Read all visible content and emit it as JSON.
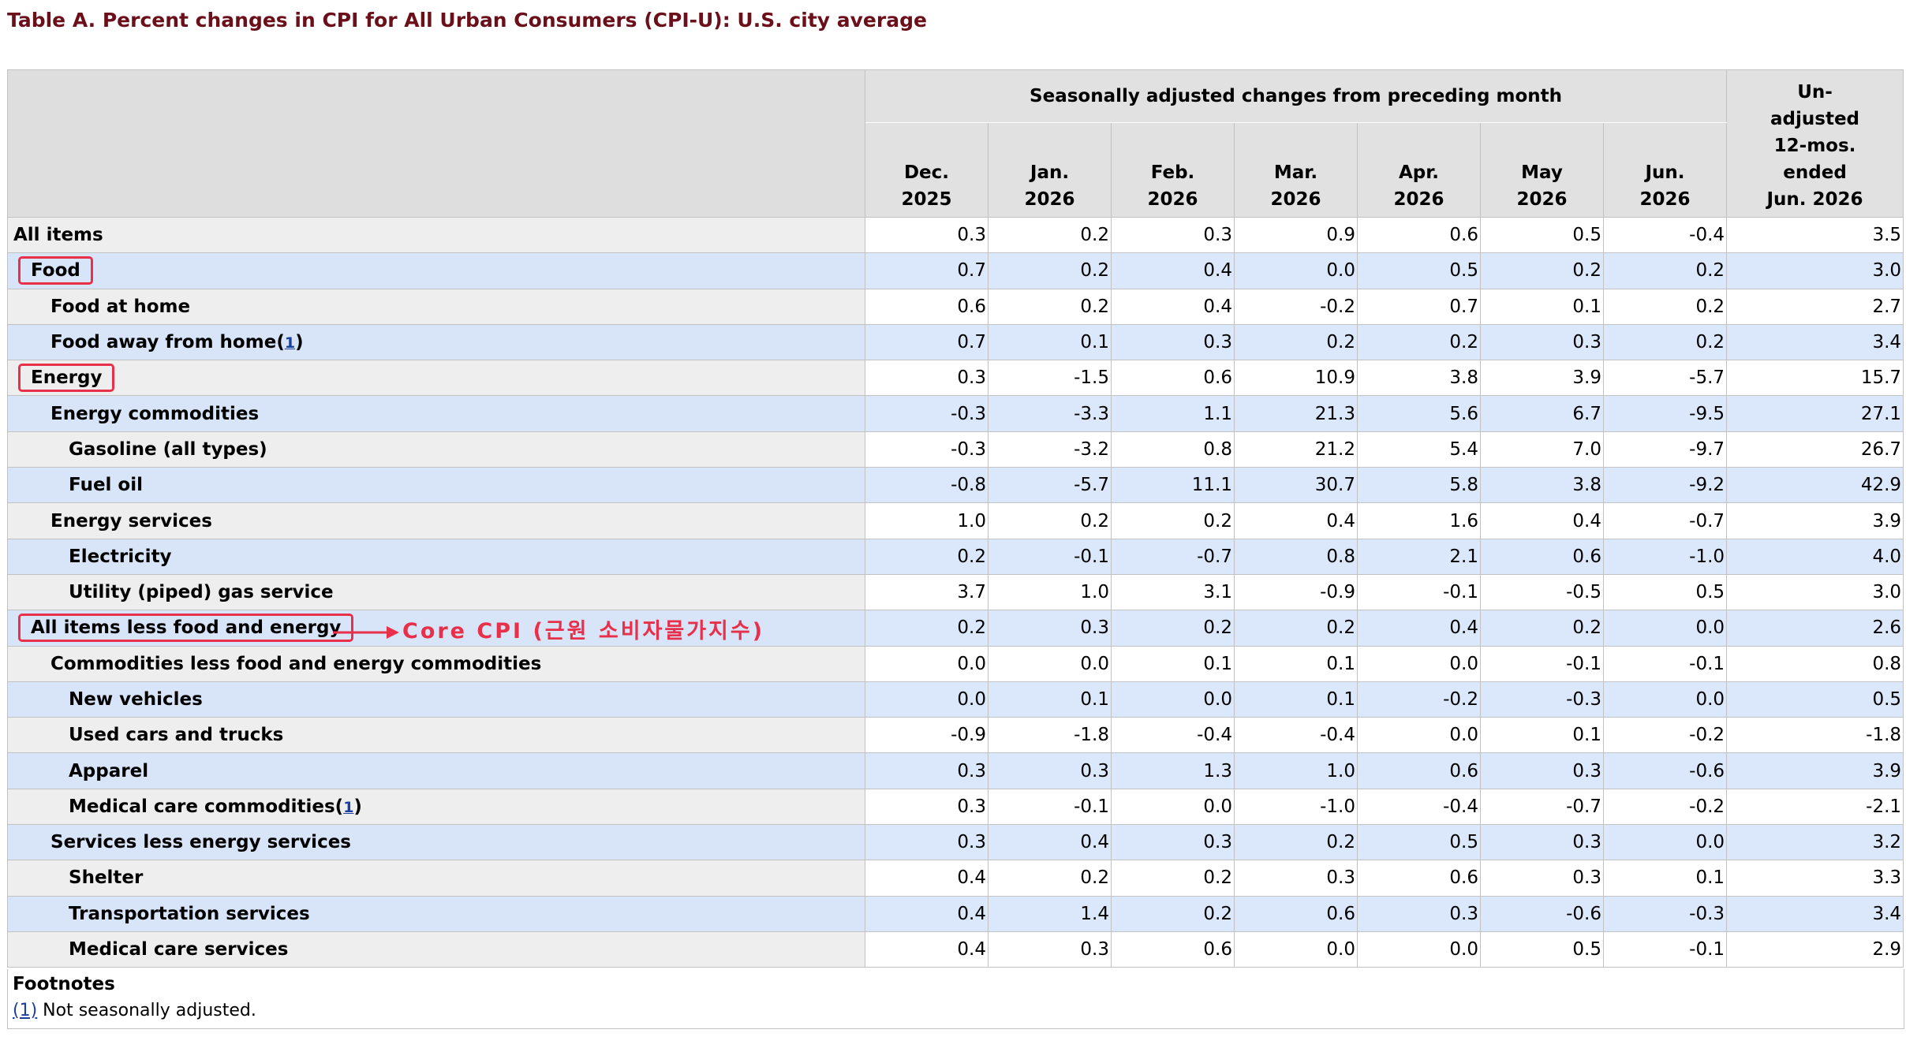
{
  "title": "Table A. Percent changes in CPI for All Urban Consumers (CPI-U): U.S. city average",
  "header": {
    "group": "Seasonally adjusted changes from preceding month",
    "months": [
      [
        "Dec.",
        "2025"
      ],
      [
        "Jan.",
        "2026"
      ],
      [
        "Feb.",
        "2026"
      ],
      [
        "Mar.",
        "2026"
      ],
      [
        "Apr.",
        "2026"
      ],
      [
        "May",
        "2026"
      ],
      [
        "Jun.",
        "2026"
      ]
    ],
    "unadjusted": [
      "Un-",
      "adjusted",
      "12-mos.",
      "ended",
      "Jun. 2026"
    ]
  },
  "rows": [
    {
      "label": "All items",
      "indent": 0,
      "boxed": false,
      "values": [
        "0.3",
        "0.2",
        "0.3",
        "0.9",
        "0.6",
        "0.5",
        "-0.4",
        "3.5"
      ]
    },
    {
      "label": "Food",
      "indent": 0,
      "boxed": true,
      "values": [
        "0.7",
        "0.2",
        "0.4",
        "0.0",
        "0.5",
        "0.2",
        "0.2",
        "3.0"
      ]
    },
    {
      "label": "Food at home",
      "indent": 1,
      "boxed": false,
      "values": [
        "0.6",
        "0.2",
        "0.4",
        "-0.2",
        "0.7",
        "0.1",
        "0.2",
        "2.7"
      ]
    },
    {
      "label": "Food away from home",
      "indent": 1,
      "boxed": false,
      "footnote": "1",
      "values": [
        "0.7",
        "0.1",
        "0.3",
        "0.2",
        "0.2",
        "0.3",
        "0.2",
        "3.4"
      ]
    },
    {
      "label": "Energy",
      "indent": 0,
      "boxed": true,
      "values": [
        "0.3",
        "-1.5",
        "0.6",
        "10.9",
        "3.8",
        "3.9",
        "-5.7",
        "15.7"
      ]
    },
    {
      "label": "Energy commodities",
      "indent": 1,
      "boxed": false,
      "values": [
        "-0.3",
        "-3.3",
        "1.1",
        "21.3",
        "5.6",
        "6.7",
        "-9.5",
        "27.1"
      ]
    },
    {
      "label": "Gasoline (all types)",
      "indent": 2,
      "boxed": false,
      "values": [
        "-0.3",
        "-3.2",
        "0.8",
        "21.2",
        "5.4",
        "7.0",
        "-9.7",
        "26.7"
      ]
    },
    {
      "label": "Fuel oil",
      "indent": 2,
      "boxed": false,
      "values": [
        "-0.8",
        "-5.7",
        "11.1",
        "30.7",
        "5.8",
        "3.8",
        "-9.2",
        "42.9"
      ]
    },
    {
      "label": "Energy services",
      "indent": 1,
      "boxed": false,
      "values": [
        "1.0",
        "0.2",
        "0.2",
        "0.4",
        "1.6",
        "0.4",
        "-0.7",
        "3.9"
      ]
    },
    {
      "label": "Electricity",
      "indent": 2,
      "boxed": false,
      "values": [
        "0.2",
        "-0.1",
        "-0.7",
        "0.8",
        "2.1",
        "0.6",
        "-1.0",
        "4.0"
      ]
    },
    {
      "label": "Utility (piped) gas service",
      "indent": 2,
      "boxed": false,
      "values": [
        "3.7",
        "1.0",
        "3.1",
        "-0.9",
        "-0.1",
        "-0.5",
        "0.5",
        "3.0"
      ]
    },
    {
      "label": "All items less food and energy",
      "indent": 0,
      "boxed": true,
      "annotation": "Core CPI (근원 소비자물가지수)",
      "values": [
        "0.2",
        "0.3",
        "0.2",
        "0.2",
        "0.4",
        "0.2",
        "0.0",
        "2.6"
      ]
    },
    {
      "label": "Commodities less food and energy commodities",
      "indent": 1,
      "boxed": false,
      "values": [
        "0.0",
        "0.0",
        "0.1",
        "0.1",
        "0.0",
        "-0.1",
        "-0.1",
        "0.8"
      ]
    },
    {
      "label": "New vehicles",
      "indent": 2,
      "boxed": false,
      "values": [
        "0.0",
        "0.1",
        "0.0",
        "0.1",
        "-0.2",
        "-0.3",
        "0.0",
        "0.5"
      ]
    },
    {
      "label": "Used cars and trucks",
      "indent": 2,
      "boxed": false,
      "values": [
        "-0.9",
        "-1.8",
        "-0.4",
        "-0.4",
        "0.0",
        "0.1",
        "-0.2",
        "-1.8"
      ]
    },
    {
      "label": "Apparel",
      "indent": 2,
      "boxed": false,
      "values": [
        "0.3",
        "0.3",
        "1.3",
        "1.0",
        "0.6",
        "0.3",
        "-0.6",
        "3.9"
      ]
    },
    {
      "label": "Medical care commodities",
      "indent": 2,
      "boxed": false,
      "footnote": "1",
      "values": [
        "0.3",
        "-0.1",
        "0.0",
        "-1.0",
        "-0.4",
        "-0.7",
        "-0.2",
        "-2.1"
      ]
    },
    {
      "label": "Services less energy services",
      "indent": 1,
      "boxed": false,
      "values": [
        "0.3",
        "0.4",
        "0.3",
        "0.2",
        "0.5",
        "0.3",
        "0.0",
        "3.2"
      ]
    },
    {
      "label": "Shelter",
      "indent": 2,
      "boxed": false,
      "values": [
        "0.4",
        "0.2",
        "0.2",
        "0.3",
        "0.6",
        "0.3",
        "0.1",
        "3.3"
      ]
    },
    {
      "label": "Transportation services",
      "indent": 2,
      "boxed": false,
      "values": [
        "0.4",
        "1.4",
        "0.2",
        "0.6",
        "0.3",
        "-0.6",
        "-0.3",
        "3.4"
      ]
    },
    {
      "label": "Medical care services",
      "indent": 2,
      "boxed": false,
      "values": [
        "0.4",
        "0.3",
        "0.6",
        "0.0",
        "0.0",
        "0.5",
        "-0.1",
        "2.9"
      ]
    }
  ],
  "footnotes": {
    "title": "Footnotes",
    "items": [
      {
        "ref": "(1)",
        "text": " Not seasonally adjusted."
      }
    ]
  },
  "colors": {
    "title": "#6b0f1a",
    "annotation": "#e8304a",
    "link": "#1a3fa0",
    "row_blue": "#dbe7fa",
    "header_gray": "#e1e1e1"
  }
}
